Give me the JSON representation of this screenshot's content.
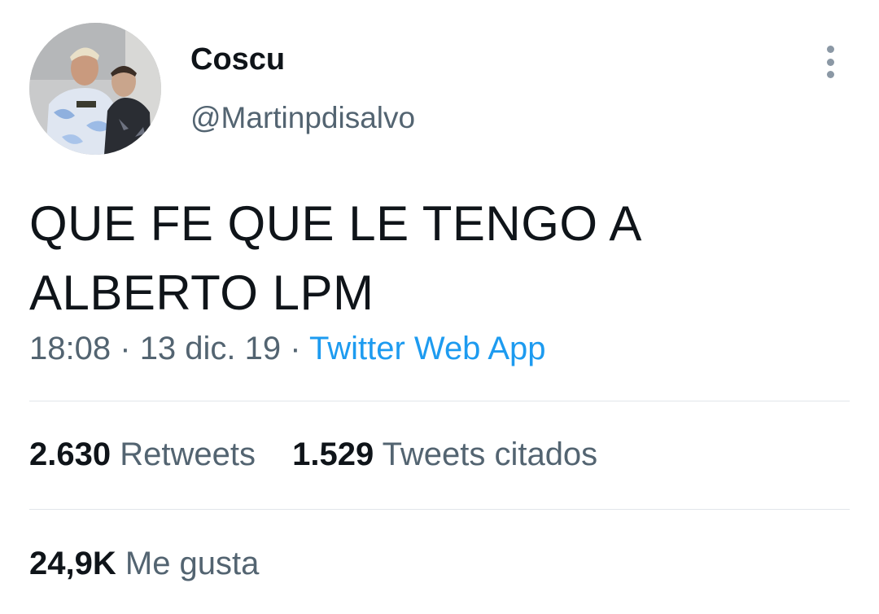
{
  "author": {
    "display_name": "Coscu",
    "handle": "@Martinpdisalvo",
    "avatar_icon": "profile-photo"
  },
  "tweet": {
    "text_line1": "QUE FE QUE LE TENGO A",
    "text_line2": "ALBERTO LPM"
  },
  "meta": {
    "time": "18:08",
    "separator": "·",
    "date": "13 dic. 19",
    "source": "Twitter Web App"
  },
  "stats": {
    "retweets_count": "2.630",
    "retweets_label": "Retweets",
    "quotes_count": "1.529",
    "quotes_label": "Tweets citados",
    "likes_count": "24,9K",
    "likes_label": "Me gusta"
  },
  "colors": {
    "text_primary": "#0f1419",
    "text_secondary": "#536471",
    "link": "#1d9bf0",
    "divider": "#e1e6ea"
  },
  "icons": {
    "more": "more-vertical-icon"
  }
}
